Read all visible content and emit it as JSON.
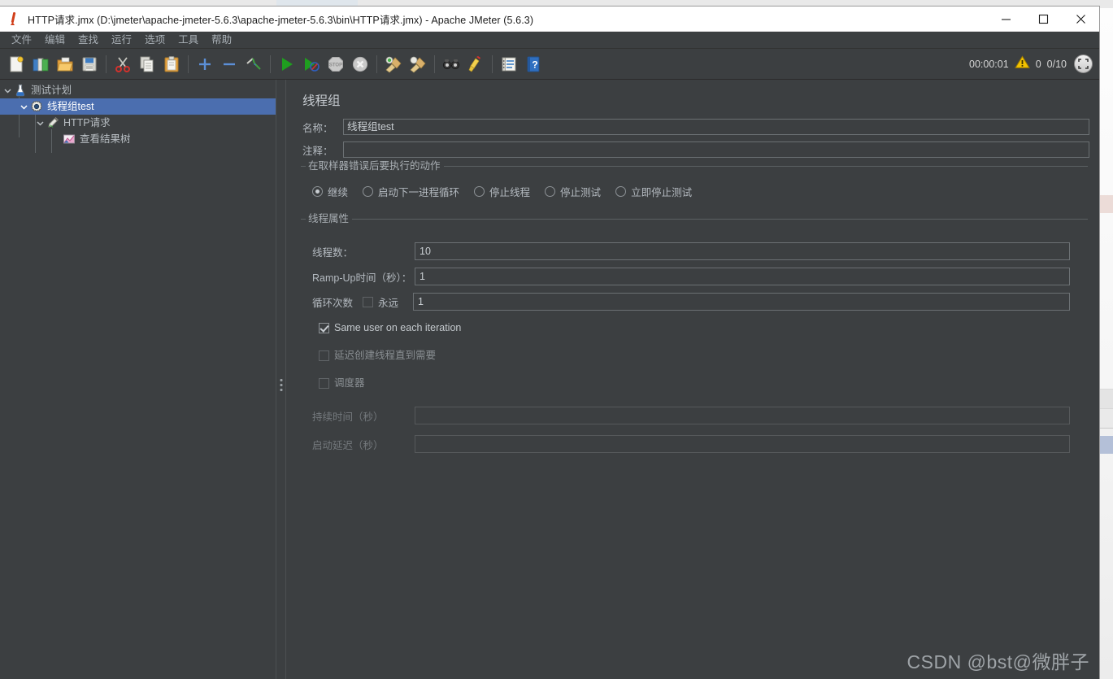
{
  "window": {
    "title": "HTTP请求.jmx (D:\\jmeter\\apache-jmeter-5.6.3\\apache-jmeter-5.6.3\\bin\\HTTP请求.jmx) - Apache JMeter (5.6.3)",
    "app_icon": "jmeter-feather-icon",
    "controls": {
      "minimize": "minimize-icon",
      "maximize": "maximize-icon",
      "close": "close-icon"
    }
  },
  "menubar": {
    "items": [
      {
        "label": "文件"
      },
      {
        "label": "编辑"
      },
      {
        "label": "查找"
      },
      {
        "label": "运行"
      },
      {
        "label": "选项"
      },
      {
        "label": "工具"
      },
      {
        "label": "帮助"
      }
    ]
  },
  "toolbar": {
    "buttons": [
      {
        "name": "new-icon",
        "title": "新建"
      },
      {
        "name": "templates-icon",
        "title": "模板"
      },
      {
        "name": "open-icon",
        "title": "打开"
      },
      {
        "name": "save-icon",
        "title": "保存"
      },
      {
        "name": "cut-icon",
        "title": "剪切"
      },
      {
        "name": "copy-icon",
        "title": "复制"
      },
      {
        "name": "paste-icon",
        "title": "粘贴"
      },
      {
        "name": "expand-all-icon",
        "title": "展开全部"
      },
      {
        "name": "collapse-all-icon",
        "title": "折叠全部"
      },
      {
        "name": "toggle-icon",
        "title": "切换"
      },
      {
        "name": "start-icon",
        "title": "启动"
      },
      {
        "name": "start-no-pauses-icon",
        "title": "无停顿启动"
      },
      {
        "name": "stop-icon",
        "title": "停止"
      },
      {
        "name": "shutdown-icon",
        "title": "关闭"
      },
      {
        "name": "clear-icon",
        "title": "清除"
      },
      {
        "name": "clear-all-icon",
        "title": "清除全部"
      },
      {
        "name": "search-icon",
        "title": "查找"
      },
      {
        "name": "reset-search-icon",
        "title": "重置查找"
      },
      {
        "name": "function-helper-icon",
        "title": "函数助手对话框"
      },
      {
        "name": "help-icon",
        "title": "帮助"
      }
    ],
    "status": {
      "timer": "00:00:01",
      "warning_icon": "warning-triangle-icon",
      "error_count": "0",
      "threads": "0/10",
      "remote_icon": "remote-nodes-icon"
    }
  },
  "tree": {
    "nodes": [
      {
        "label": "测试计划",
        "icon": "test-plan-icon",
        "depth": 0,
        "expanded": true,
        "selected": false
      },
      {
        "label": "线程组test",
        "icon": "thread-group-icon",
        "depth": 1,
        "expanded": true,
        "selected": true
      },
      {
        "label": "HTTP请求",
        "icon": "http-sampler-icon",
        "depth": 2,
        "expanded": true,
        "selected": false
      },
      {
        "label": "查看结果树",
        "icon": "view-results-tree-icon",
        "depth": 3,
        "expanded": false,
        "selected": false
      }
    ]
  },
  "editor": {
    "panel_title": "线程组",
    "name_label": "名称：",
    "name_value": "线程组test",
    "comment_label": "注释：",
    "comment_value": "",
    "comment_placeholder": "",
    "action_group": {
      "title": "在取样器错误后要执行的动作",
      "options": [
        {
          "label": "继续",
          "selected": true
        },
        {
          "label": "启动下一进程循环",
          "selected": false
        },
        {
          "label": "停止线程",
          "selected": false
        },
        {
          "label": "停止测试",
          "selected": false
        },
        {
          "label": "立即停止测试",
          "selected": false
        }
      ]
    },
    "thread_group": {
      "title": "线程属性",
      "threads_label": "线程数：",
      "threads_value": "10",
      "rampup_label": "Ramp-Up时间（秒）：",
      "rampup_value": "1",
      "loops_label": "循环次数",
      "forever_label": "永远",
      "forever_checked": false,
      "loops_value": "1",
      "same_user_label": "Same user on each iteration",
      "same_user_checked": true,
      "delay_create_label": "延迟创建线程直到需要",
      "delay_create_checked": false,
      "scheduler_label": "调度器",
      "scheduler_checked": false,
      "duration_label": "持续时间（秒）",
      "duration_value": "",
      "startup_delay_label": "启动延迟（秒）",
      "startup_delay_value": ""
    }
  },
  "watermark": {
    "text": "CSDN @bst@微胖子"
  },
  "colors": {
    "window_bg": "#3c3f41",
    "selection_blue": "#4b6eaf",
    "text_primary": "#b9bfc4",
    "border": "#6b7073",
    "accent_green": "#2f9e2f",
    "warning_yellow": "#f2c200"
  }
}
